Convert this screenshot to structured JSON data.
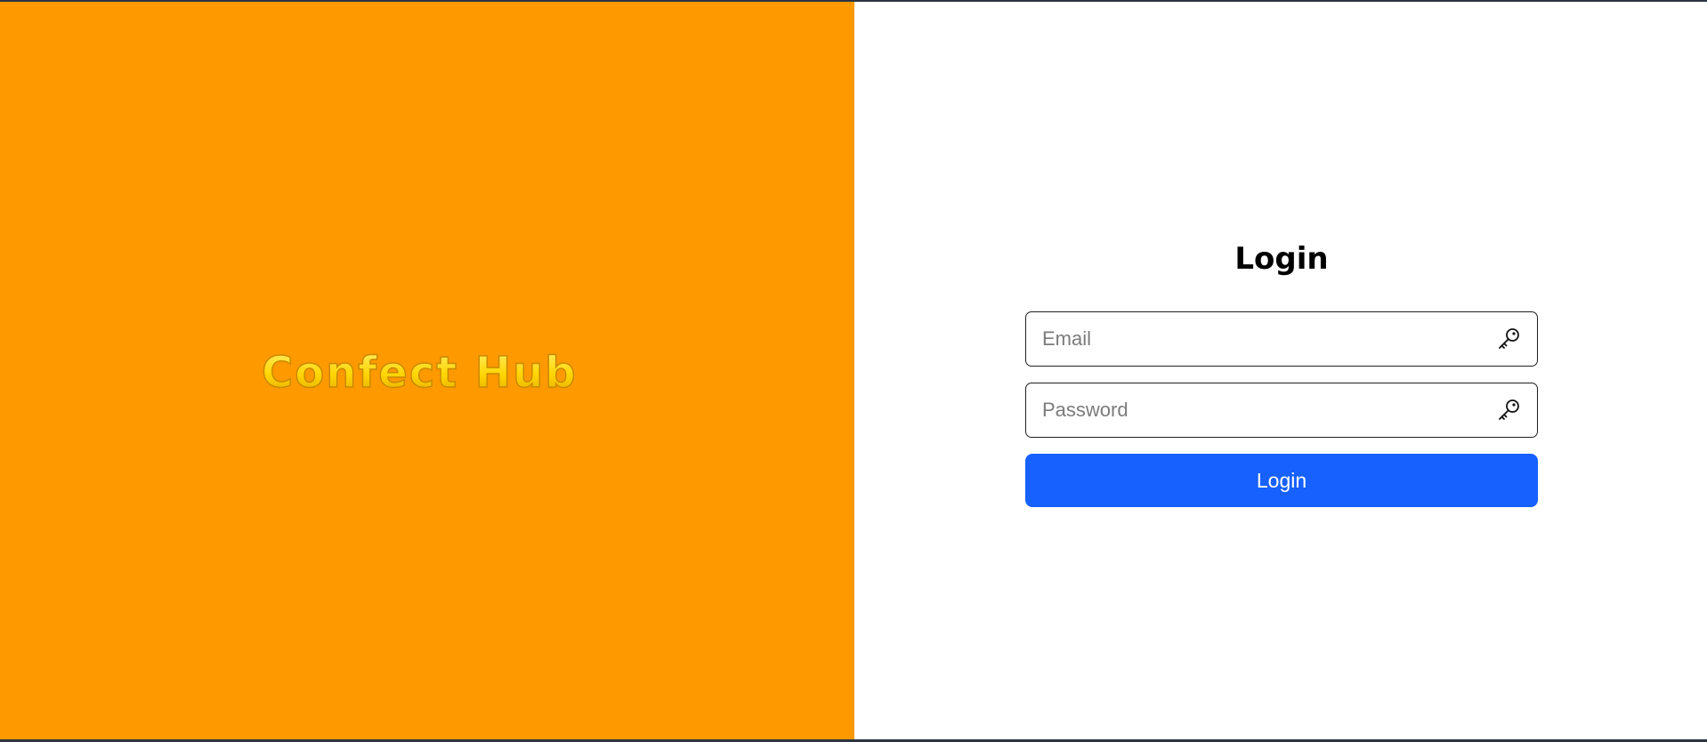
{
  "brand": {
    "name": "Confect Hub",
    "background_color": "#ff9900",
    "logo_color": "#ffd400"
  },
  "login": {
    "title": "Login",
    "email_placeholder": "Email",
    "email_value": "",
    "email_icon": "key-icon",
    "password_placeholder": "Password",
    "password_value": "",
    "password_icon": "key-icon",
    "submit_label": "Login",
    "accent_color": "#1661ff"
  }
}
